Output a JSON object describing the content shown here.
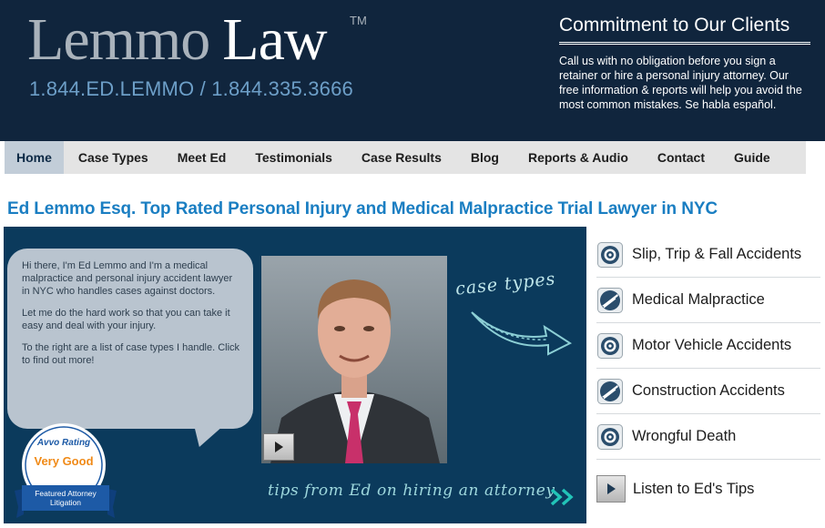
{
  "header": {
    "logo_first": "Lemmo",
    "logo_second": "Law",
    "trademark": "TM",
    "phone": "1.844.ED.LEMMO / 1.844.335.3666",
    "commitment_title": "Commitment to Our Clients",
    "commitment_text": "Call us with no obligation before you sign a retainer or hire a personal injury attorney. Our free information & reports will help you avoid the most common mistakes.    Se habla español."
  },
  "nav": {
    "items": [
      "Home",
      "Case Types",
      "Meet Ed",
      "Testimonials",
      "Case Results",
      "Blog",
      "Reports & Audio",
      "Contact",
      "Guide"
    ],
    "active": "Home"
  },
  "headline": "Ed Lemmo Esq. Top Rated Personal Injury and Medical Malpractice Trial Lawyer in NYC",
  "hero": {
    "bubble_paragraphs": [
      "Hi there, I'm Ed Lemmo and I'm a medical malpractice and personal injury accident lawyer in NYC who handles cases against doctors.",
      "Let me do the hard work so that you can take it easy and deal with your injury.",
      "To the right are a list of case types I handle. Click to find out more!"
    ],
    "case_types_script": "case types",
    "tips_script": "tips from Ed on hiring an attorney",
    "avvo": {
      "brand": "Avvo Rating",
      "rating": "Very Good",
      "ribbon_line1": "Featured Attorney",
      "ribbon_line2": "Litigation"
    }
  },
  "case_types": [
    {
      "label": "Slip, Trip & Fall Accidents",
      "icon": "target-icon"
    },
    {
      "label": "Medical Malpractice",
      "icon": "scalpel-icon"
    },
    {
      "label": "Motor Vehicle Accidents",
      "icon": "target-icon"
    },
    {
      "label": "Construction Accidents",
      "icon": "scalpel-icon"
    },
    {
      "label": "Wrongful Death",
      "icon": "target-icon"
    }
  ],
  "listen_label": "Listen to Ed's Tips",
  "colors": {
    "header_bg": "#10253d",
    "headline": "#1a7ec2",
    "hero_bg": "#0b3a5c",
    "nav_bg": "#e4e4e4",
    "nav_active": "#c2cdd8",
    "avvo_orange": "#f08a17",
    "avvo_blue": "#1d5aa6"
  }
}
